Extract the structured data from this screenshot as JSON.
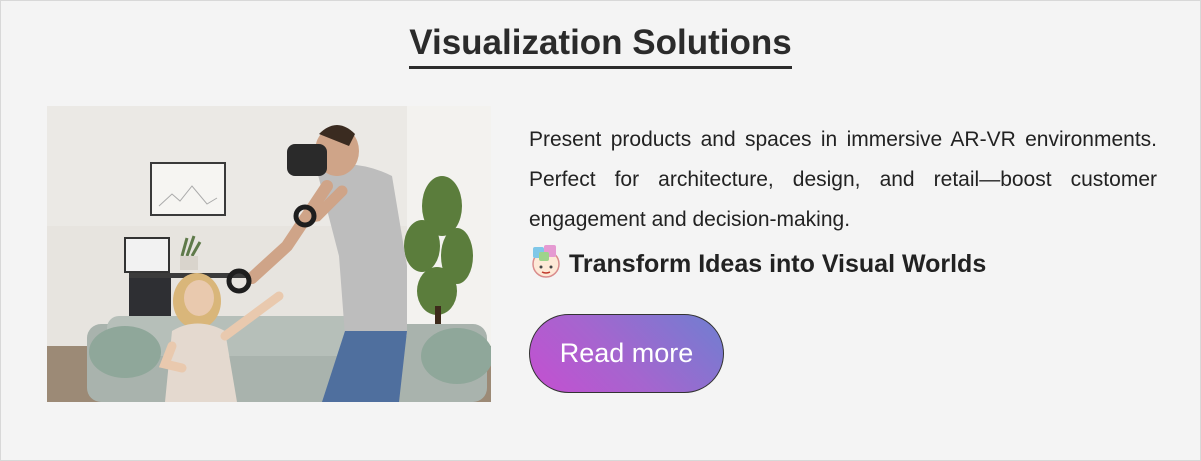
{
  "section": {
    "title": "Visualization Solutions"
  },
  "content": {
    "description": "Present products and spaces in immersive AR-VR environments. Perfect for architecture, design, and retail—boost customer engagement and decision-making.",
    "subheading_icon": "vr-headset-emoji-icon",
    "subheading": "Transform Ideas into Visual Worlds",
    "button_label": "Read more"
  },
  "image": {
    "subject": "vr-living-room-photo"
  },
  "colors": {
    "background": "#f4f4f4",
    "title": "#2b2b2b",
    "button_gradient_start": "#c54fd0",
    "button_gradient_end": "#6f7fd0"
  }
}
